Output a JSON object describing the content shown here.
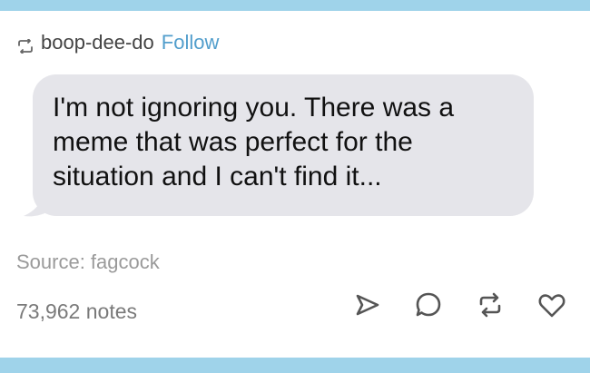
{
  "post": {
    "username": "boop-dee-do",
    "follow_label": "Follow",
    "message": "I'm not ignoring you. There was a meme that was perfect for the situation and I can't find it...",
    "source": "Source: fagcock",
    "notes": "73,962 notes"
  },
  "icons": {
    "header": "reblog-icon",
    "actions": [
      "share-icon",
      "reply-icon",
      "reblog-icon",
      "like-icon"
    ]
  },
  "colors": {
    "frame": "#9fd3ea",
    "background": "#ffffff",
    "bubble": "#e5e5ea",
    "follow": "#529ecc",
    "icon": "#555555"
  }
}
